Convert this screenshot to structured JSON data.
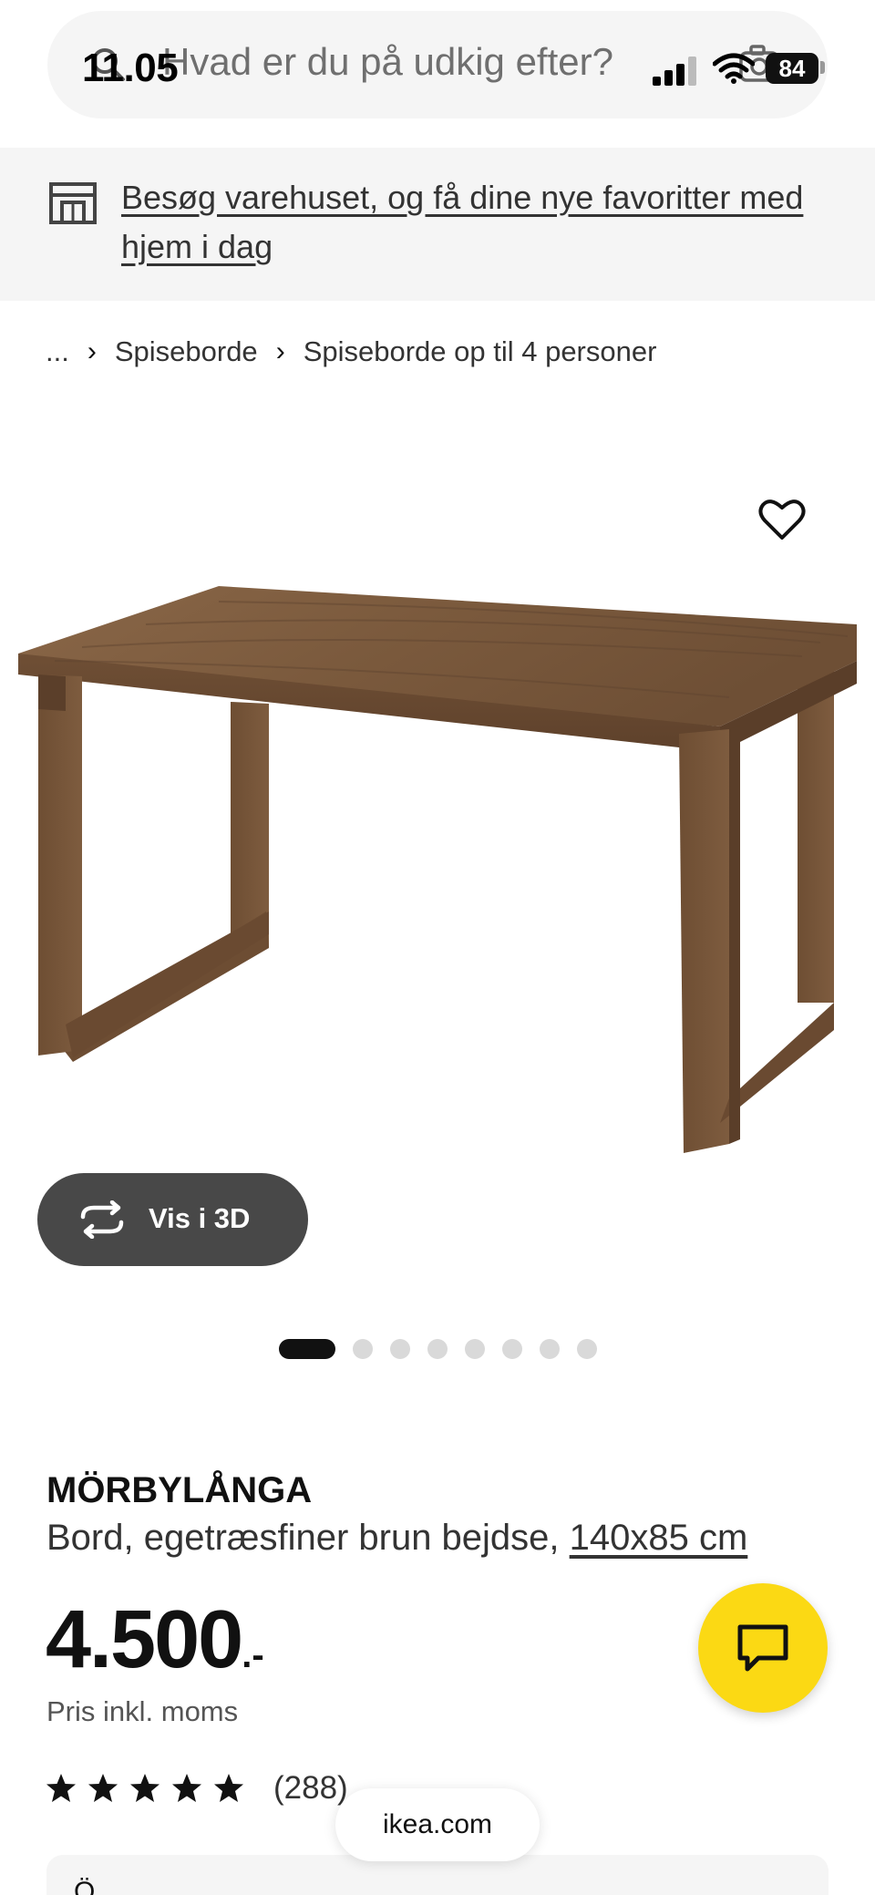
{
  "status_bar": {
    "time": "11.05",
    "battery": "84"
  },
  "search": {
    "placeholder": "Hvad er du på udkig efter?"
  },
  "store_banner": {
    "text": "Besøg varehuset, og få dine nye favoritter med hjem i dag"
  },
  "breadcrumb": {
    "items": [
      "...",
      "Spiseborde",
      "Spiseborde op til 4 personer"
    ]
  },
  "view3d": {
    "label": "Vis i 3D"
  },
  "carousel": {
    "total_images": 8,
    "active_index": 0
  },
  "product": {
    "name": "MÖRBYLÅNGA",
    "description": "Bord, egetræsfiner brun bejdse, ",
    "size": "140x85 cm",
    "price": "4.500",
    "price_suffix": ".-",
    "price_note": "Pris inkl. moms",
    "rating": 5,
    "review_count": "(288)"
  },
  "browser": {
    "url": "ikea.com"
  },
  "bottom_card": {
    "label": "Ö"
  },
  "colors": {
    "accent_yellow": "#fbd914",
    "wood": "#7a5a3e",
    "pill_dark": "#484848"
  }
}
